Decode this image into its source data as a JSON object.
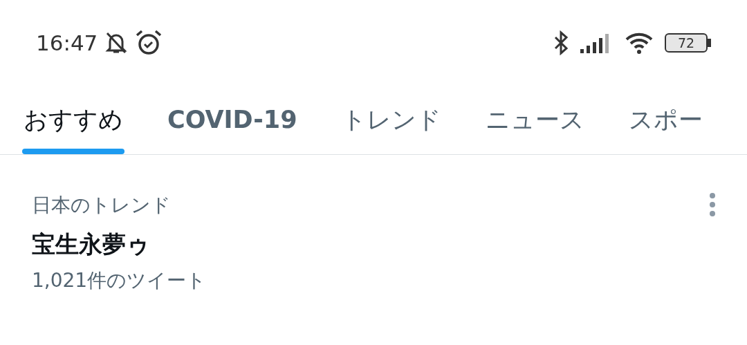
{
  "status_bar": {
    "time": "16:47",
    "battery": "72"
  },
  "tabs": [
    {
      "label": "おすすめ",
      "selected": true,
      "bold": false
    },
    {
      "label": "COVID-19",
      "selected": false,
      "bold": true
    },
    {
      "label": "トレンド",
      "selected": false,
      "bold": false
    },
    {
      "label": "ニュース",
      "selected": false,
      "bold": false
    },
    {
      "label": "スポー",
      "selected": false,
      "bold": false
    }
  ],
  "trend": {
    "context": "日本のトレンド",
    "title": "宝生永夢ゥ",
    "count": "1,021件のツイート"
  }
}
